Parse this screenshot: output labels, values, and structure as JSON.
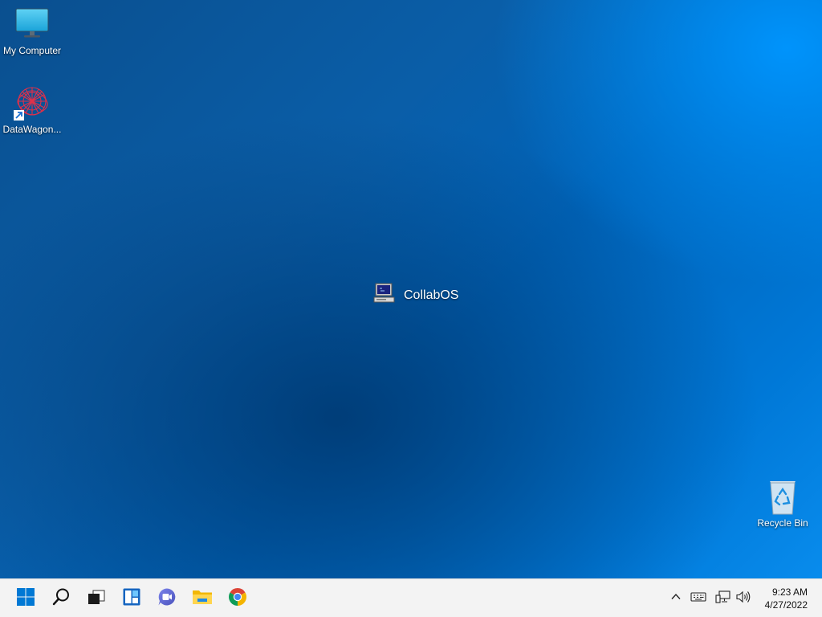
{
  "desktop": {
    "icons": [
      {
        "label": "My Computer",
        "icon": "monitor-icon"
      },
      {
        "label": "DataWagon...",
        "icon": "datawagon-logo-icon"
      },
      {
        "label": "Recycle Bin",
        "icon": "recycle-bin-icon"
      }
    ],
    "center_app": {
      "label": "CollabOS",
      "icon": "computer-terminal-icon"
    }
  },
  "taskbar": {
    "buttons": [
      {
        "name": "start",
        "icon": "windows-logo-icon"
      },
      {
        "name": "search",
        "icon": "search-icon"
      },
      {
        "name": "task-view",
        "icon": "task-view-icon"
      },
      {
        "name": "widgets",
        "icon": "widgets-icon"
      },
      {
        "name": "chat",
        "icon": "chat-icon"
      },
      {
        "name": "file-explorer",
        "icon": "folder-icon"
      },
      {
        "name": "chrome",
        "icon": "chrome-icon"
      }
    ],
    "tray": [
      {
        "name": "show-hidden",
        "icon": "chevron-up-icon"
      },
      {
        "name": "keyboard",
        "icon": "keyboard-icon"
      },
      {
        "name": "network",
        "icon": "network-icon"
      },
      {
        "name": "volume",
        "icon": "speaker-icon"
      }
    ],
    "clock": {
      "time": "9:23 AM",
      "date": "4/27/2022"
    }
  },
  "colors": {
    "accent": "#0078d7",
    "taskbar": "#f3f3f3"
  }
}
